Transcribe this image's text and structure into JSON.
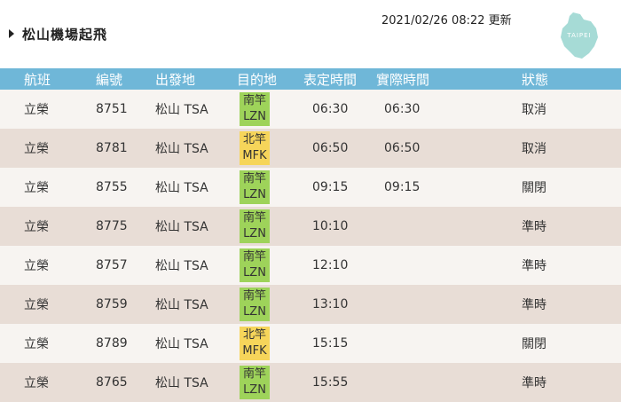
{
  "header": {
    "title": "松山機場起飛",
    "updated": "2021/02/26 08:22 更新",
    "logo_text": "TAIPEI"
  },
  "columns": [
    "航班",
    "編號",
    "出發地",
    "目的地",
    "表定時間",
    "實際時間",
    "狀態"
  ],
  "colors": {
    "header_bg": "#6fb7d8",
    "row_light": "#f7f4f1",
    "row_dark": "#e8ddd6",
    "dest_green": "#9ed35a",
    "dest_yellow": "#f6d55a"
  },
  "rows": [
    {
      "airline": "立榮",
      "flight": "8751",
      "from": "松山 TSA",
      "dest_zh": "南竿",
      "dest_code": "LZN",
      "dest_color": "green",
      "scheduled": "06:30",
      "actual": "06:30",
      "status": "取消"
    },
    {
      "airline": "立榮",
      "flight": "8781",
      "from": "松山 TSA",
      "dest_zh": "北竿",
      "dest_code": "MFK",
      "dest_color": "yellow",
      "scheduled": "06:50",
      "actual": "06:50",
      "status": "取消"
    },
    {
      "airline": "立榮",
      "flight": "8755",
      "from": "松山 TSA",
      "dest_zh": "南竿",
      "dest_code": "LZN",
      "dest_color": "green",
      "scheduled": "09:15",
      "actual": "09:15",
      "status": "關閉"
    },
    {
      "airline": "立榮",
      "flight": "8775",
      "from": "松山 TSA",
      "dest_zh": "南竿",
      "dest_code": "LZN",
      "dest_color": "green",
      "scheduled": "10:10",
      "actual": "",
      "status": "準時"
    },
    {
      "airline": "立榮",
      "flight": "8757",
      "from": "松山 TSA",
      "dest_zh": "南竿",
      "dest_code": "LZN",
      "dest_color": "green",
      "scheduled": "12:10",
      "actual": "",
      "status": "準時"
    },
    {
      "airline": "立榮",
      "flight": "8759",
      "from": "松山 TSA",
      "dest_zh": "南竿",
      "dest_code": "LZN",
      "dest_color": "green",
      "scheduled": "13:10",
      "actual": "",
      "status": "準時"
    },
    {
      "airline": "立榮",
      "flight": "8789",
      "from": "松山 TSA",
      "dest_zh": "北竿",
      "dest_code": "MFK",
      "dest_color": "yellow",
      "scheduled": "15:15",
      "actual": "",
      "status": "關閉"
    },
    {
      "airline": "立榮",
      "flight": "8765",
      "from": "松山 TSA",
      "dest_zh": "南竿",
      "dest_code": "LZN",
      "dest_color": "green",
      "scheduled": "15:55",
      "actual": "",
      "status": "準時"
    }
  ]
}
